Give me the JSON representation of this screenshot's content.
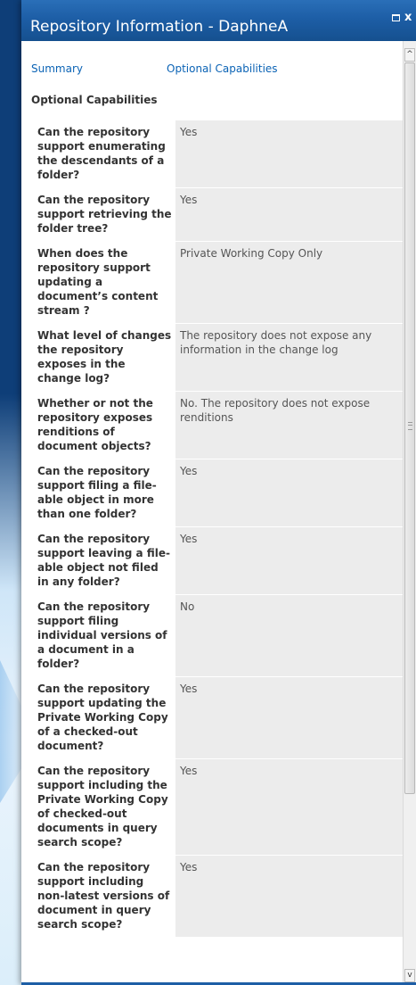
{
  "window": {
    "title": "Repository Information - DaphneA",
    "maximize_icon": "maximize-icon",
    "close_label": "x"
  },
  "nav": {
    "summary": "Summary",
    "optional": "Optional Capabilities"
  },
  "section_heading": "Optional Capabilities",
  "rows": [
    {
      "label": "Can the repository support enumerating the descendants of a folder?",
      "value": "Yes"
    },
    {
      "label": "Can the repository support retrieving the folder tree?",
      "value": "Yes"
    },
    {
      "label": "When does the repository support updating a document’s content stream ?",
      "value": "Private Working Copy Only"
    },
    {
      "label": "What level of changes the repository exposes in the change log?",
      "value": "The repository does not expose any information in the change log"
    },
    {
      "label": "Whether or not the repository exposes renditions of document objects?",
      "value": "No. The repository does not expose renditions"
    },
    {
      "label": "Can the repository support filing a file-able object in more than one folder?",
      "value": "Yes"
    },
    {
      "label": "Can the repository support leaving a file-able object not filed in any folder?",
      "value": "Yes"
    },
    {
      "label": "Can the repository support filing individual versions of a document in a folder?",
      "value": "No"
    },
    {
      "label": "Can the repository support updating the Private Working Copy of a checked-out document?",
      "value": "Yes"
    },
    {
      "label": "Can the repository support including the Private Working Copy of checked-out documents in query search scope?",
      "value": "Yes"
    },
    {
      "label": "Can the repository support including non-latest versions of document in query search scope?",
      "value": "Yes"
    }
  ],
  "scrollbar": {
    "up_arrow": "^",
    "down_arrow": "v"
  }
}
